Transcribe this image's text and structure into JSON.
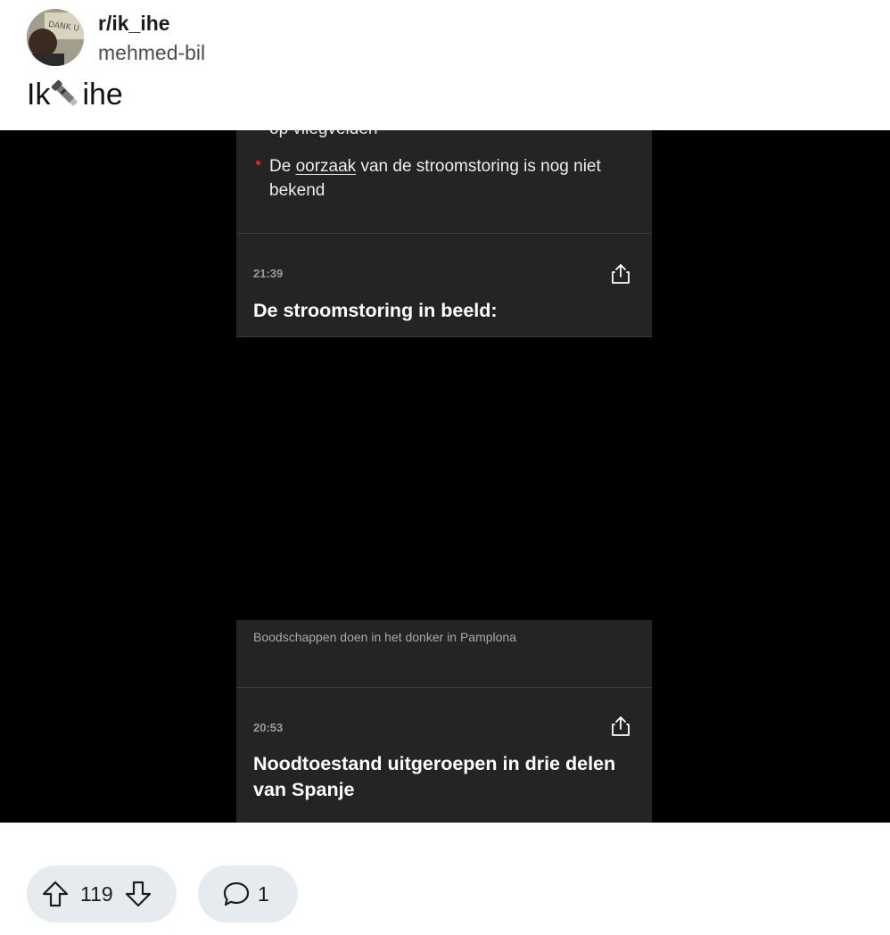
{
  "post": {
    "subreddit": "r/ik_ihe",
    "author": "mehmed-bil",
    "title_before": "Ik",
    "title_emoji": "flashlight-emoji",
    "title_after": "ihe"
  },
  "media": {
    "cut_off_text": "op vliegvelden",
    "bullet_prefix": "De ",
    "bullet_link": "oorzaak",
    "bullet_suffix": " van de stroomstoring is nog niet bekend",
    "entries": [
      {
        "time": "21:39",
        "headline": "De stroomstoring in beeld:"
      },
      {
        "time": "20:53",
        "headline": "Noodtoestand uitgeroepen in drie delen van Spanje"
      }
    ],
    "video_caption": "Boodschappen doen in het donker in Pamplona",
    "bullet_color": "#e0242b"
  },
  "actions": {
    "score": "119",
    "comments": "1",
    "upvote_icon": "upvote-arrow-icon",
    "downvote_icon": "downvote-arrow-icon",
    "comment_icon": "comment-bubble-icon"
  }
}
